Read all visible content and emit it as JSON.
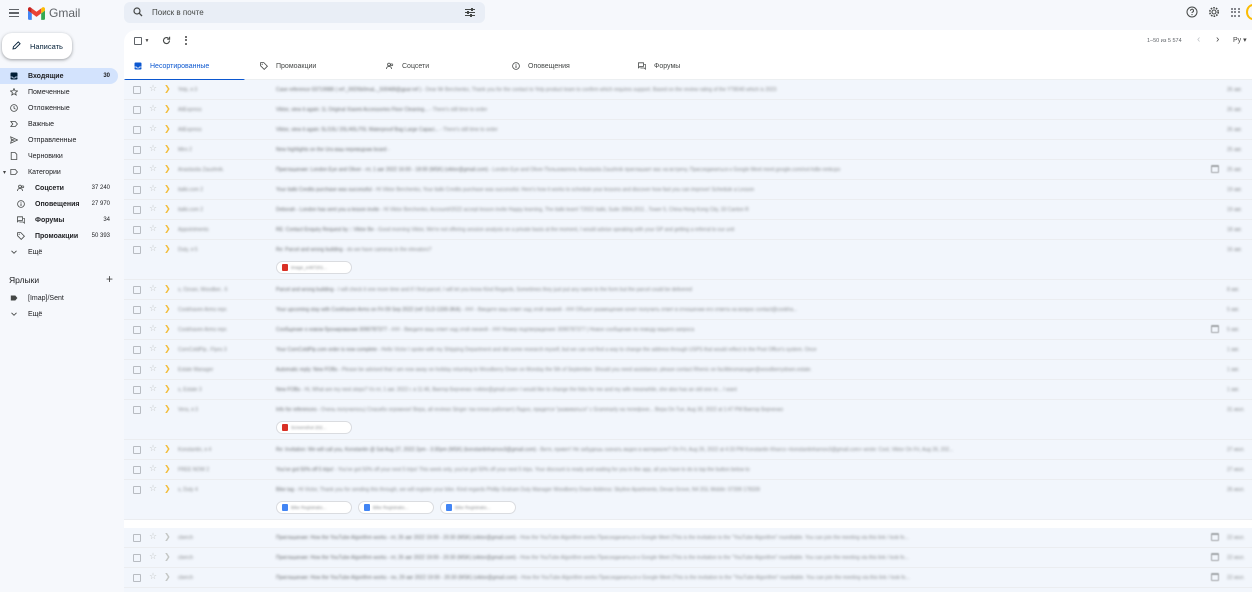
{
  "app": {
    "name": "Gmail"
  },
  "search": {
    "placeholder": "Поиск в почте"
  },
  "compose": {
    "label": "Написать"
  },
  "nav": [
    {
      "id": "inbox",
      "label": "Входящие",
      "count": "30",
      "icon": "inbox-icon"
    },
    {
      "id": "starred",
      "label": "Помеченные",
      "count": "",
      "icon": "star-icon"
    },
    {
      "id": "snoozed",
      "label": "Отложенные",
      "count": "",
      "icon": "clock-icon"
    },
    {
      "id": "important",
      "label": "Важные",
      "count": "",
      "icon": "important-icon"
    },
    {
      "id": "sent",
      "label": "Отправленные",
      "count": "",
      "icon": "send-icon"
    },
    {
      "id": "drafts",
      "label": "Черновики",
      "count": "",
      "icon": "draft-icon"
    },
    {
      "id": "categories",
      "label": "Категории",
      "count": "",
      "icon": "label-outline-icon"
    }
  ],
  "categories": [
    {
      "id": "social",
      "label": "Соцсети",
      "count": "37 240",
      "icon": "people-icon"
    },
    {
      "id": "updates",
      "label": "Оповещения",
      "count": "27 970",
      "icon": "info-icon"
    },
    {
      "id": "forums",
      "label": "Форумы",
      "count": "34",
      "icon": "forum-icon"
    },
    {
      "id": "promotions",
      "label": "Промоакции",
      "count": "50 393",
      "icon": "tag-icon"
    }
  ],
  "nav_more": "Ещё",
  "labels_section": {
    "title": "Ярлыки",
    "items": [
      {
        "label": "[Imap]/Sent"
      }
    ],
    "more": "Ещё"
  },
  "toolbar": {
    "paging": "1–50 из 5 574",
    "lang": "Ру"
  },
  "tabs": [
    {
      "id": "primary",
      "label": "Несортированные",
      "active": true,
      "icon": "inbox-icon"
    },
    {
      "id": "promotions",
      "label": "Промоакции",
      "active": false,
      "icon": "tag-icon"
    },
    {
      "id": "social",
      "label": "Соцсети",
      "active": false,
      "icon": "people-icon"
    },
    {
      "id": "updates",
      "label": "Оповещения",
      "active": false,
      "icon": "info-icon"
    },
    {
      "id": "forums",
      "label": "Форумы",
      "active": false,
      "icon": "forum-icon"
    }
  ],
  "emails": [
    {
      "sender": "Yelp, я 3",
      "subject": "Case reference 03719988 ( ref:_00D5b0maL._5004i8l@gpar:ref )",
      "snippet": " - Dear Mr Berchenko, Thank you for the contact to Yelp product team to confirm which requires support. Based on the review rating of the YT8040 which is 2023",
      "date": "26 авг.",
      "important": true,
      "calendar": false,
      "attachments": [],
      "tall": false,
      "gap": false
    },
    {
      "sender": "AliExpress",
      "subject": "Viktor, view it again: 1L Original Xiaomi Accessories Floor Cleaning...",
      "snippet": " - There's still time to order",
      "date": "26 авг.",
      "important": true,
      "calendar": false,
      "attachments": [],
      "tall": false,
      "gap": false
    },
    {
      "sender": "AliExpress",
      "subject": "Viktor, view it again: 5L/10L/ 20L/40L/70L Waterproof Bag Large Capaci...",
      "snippet": " - There's still time to order",
      "date": "26 авг.",
      "important": true,
      "calendar": false,
      "attachments": [],
      "tall": false,
      "gap": false
    },
    {
      "sender": "Miro 2",
      "subject": "New highlights on the Ura ваш переводчик board",
      "snippet": " - ",
      "date": "25 авг.",
      "important": true,
      "calendar": false,
      "attachments": [],
      "tall": false,
      "gap": false
    },
    {
      "sender": "Anastasiia Zaushnik.",
      "subject": "Приглашение: London Eye and Oliver - пт, 1 авг 2022 16:00 - 18:00 (MSK) (viktor@gmail.com)",
      "snippet": " - London Eye and Oliver Пользователь Anastasiia Zaushnik приглашает вас на встречу. Присоединиться к Google Meet meet.google.com/xvt-hdbr-nmkcpo",
      "date": "25 авг.",
      "important": true,
      "calendar": true,
      "attachments": [],
      "tall": false,
      "gap": false
    },
    {
      "sender": "italki.com 2",
      "subject": "Your italki Credits purchase was successful",
      "snippet": " - Hi Viktor Berchenko, Your italki Credits purchase was successful. Here's how it works to schedule your lessons and discover how fast you can improve! Schedule a Lesson",
      "date": "19 авг.",
      "important": true,
      "calendar": false,
      "attachments": [],
      "tall": false,
      "gap": false
    },
    {
      "sender": "italki.com 2",
      "subject": "Deborah - London has sent you a lesson invite",
      "snippet": " - Hi Viktor Berchenko, Account#2022 accept lesson invite Happy learning, The italki team! T2022 italki, Suite 2004,2011 , Tower 5, China Hong Kong City, 33 Canton R",
      "date": "19 авг.",
      "important": true,
      "calendar": false,
      "attachments": [],
      "tall": false,
      "gap": false
    },
    {
      "sender": "Appointments",
      "subject": "RE: Contact Enquiry Request by :: Viktor Be",
      "snippet": " - Good morning Viktor, We're not offering session analysis on a private basis at the moment, I would advise speaking with your GP and getting a referral to our unit",
      "date": "18 авг.",
      "important": true,
      "calendar": false,
      "attachments": [],
      "tall": false,
      "gap": false
    },
    {
      "sender": "Duty, я 5",
      "subject": "Re: Parcel and wrong building",
      "snippet": " - do we have cameras in the elevators?",
      "date": "16 авг.",
      "important": true,
      "calendar": false,
      "attachments": [
        {
          "name": "image_e487201...",
          "kind": "img"
        }
      ],
      "tall": true,
      "gap": false
    },
    {
      "sender": "s, Ozvan, Woodber.. 6",
      "subject": "Parcel and wrong building",
      "snippet": " - I will check it one more time and if I find parcel, I will let you know Kind Regards, Sometimes they just put any name to the form but the parcel could be delivered",
      "date": "8 авг.",
      "important": true,
      "calendar": false,
      "attachments": [],
      "tall": false,
      "gap": false
    },
    {
      "sender": "Cookhaven Arms repr.",
      "subject": "Your upcoming stay with Cookhaven Arms on Fri 09 Sep 2022 (ref: CLD-1330-3KA)",
      "snippet": " - ### - Введите ваш ответ над этой линией - ### Объект размещения хочет получить ответ в отношении его ответа на вопрос contact@cookha...",
      "date": "5 авг.",
      "important": true,
      "calendar": false,
      "attachments": [],
      "tall": false,
      "gap": false
    },
    {
      "sender": "Cookhaven Arms repr.",
      "subject": "Сообщение о новом бронировании 3090787377",
      "snippet": " - ### - Введите ваш ответ над этой линией - ### Номер подтверждения: 3090787377 | Новое сообщение по поводу вашего запроса",
      "date": "5 авг.",
      "important": true,
      "calendar": true,
      "attachments": [],
      "tall": false,
      "gap": false
    },
    {
      "sender": "CornColdPip.. Flyes 3",
      "subject": "Your CornColdPip.com order is now complete",
      "snippet": " - Hello Victor I spoke with my Shipping Department and did some research myself, but we can not find a way to change the address through USPS that would reflect in the Post Office's system. Once",
      "date": "1 авг.",
      "important": true,
      "calendar": false,
      "attachments": [],
      "tall": false,
      "gap": false
    },
    {
      "sender": "Estate Manager",
      "subject": "Automatic reply: New FOBs",
      "snippet": " - Please be advised that I am now away on holiday returning to Woodberry Down on Monday the 5th of September. Should you need assistance, please contact Rhenic on facilitiesmanager@woodberrydown.estate.",
      "date": "1 авг.",
      "important": true,
      "calendar": false,
      "attachments": [],
      "tall": false,
      "gap": false
    },
    {
      "sender": "s, Estate 3",
      "subject": "New FOBs",
      "snippet": " - Hi, What are my next steps? Vs пт, 1 авг. 2022 г. в 11:46, Виктор Берченко <viktor@gmail.com> I would like to change the fobs for me and my wife meanwhile, she also has an old one re... I want",
      "date": "1 авг.",
      "important": true,
      "calendar": false,
      "attachments": [],
      "tall": false,
      "gap": false
    },
    {
      "sender": "Vera, я 3",
      "subject": "Info for references",
      "snippet": " - Очень получилось) Спасибо огромное! Вера, all reviews Singer так плохо работает) Ладно, придется \"развиваться\" с Grammarly на телефоне... Вера On Tue, Aug 30, 2022 at 1:47 PM Виктор Берченко",
      "date": "31 июл.",
      "important": true,
      "calendar": false,
      "attachments": [
        {
          "name": "Screenshot 202...",
          "kind": "img"
        }
      ],
      "tall": true,
      "gap": false
    },
    {
      "sender": "Konstantin, я 4",
      "subject": "Re: Invitation: We will call you, Konstantin @ Sat Aug 27, 2022 2pm - 3:30pm (MSK) (konstantinharnov3@gmail.com)",
      "snippet": " - Витя, привет! Не забудешь скачать видео в материале? On Fri, Aug 26, 2022 at 4:33 PM Konstantin Kharco <konstantinharnov3@gmail.com> wrote: Cool, Viktor On Fri, Aug 26, 202...",
      "date": "27 июл.",
      "important": true,
      "calendar": false,
      "attachments": [],
      "tall": false,
      "gap": false
    },
    {
      "sender": "FREE NOW 2",
      "subject": "You've got 50% off 5 trips!",
      "snippet": " - You've got 50% off your next 5 trips! This week only, you've got 50% off your next 5 trips. Your discount is ready and waiting for you in the app, all you have to do is tap the button below to",
      "date": "27 июл.",
      "important": true,
      "calendar": false,
      "attachments": [],
      "tall": false,
      "gap": false
    },
    {
      "sender": "s, Duty 4",
      "subject": "Bike tag",
      "snippet": " - Hi Victor, Thank you for sending this through, we will register your bike. Kind regards Phillip Graham Duty Manager Woodberry Down Address: Skyline Apartments, Devan Grove, N4 2GL Mobile: 07399 178339",
      "date": "26 июл.",
      "important": true,
      "calendar": false,
      "attachments": [
        {
          "name": "Bike Registratio...",
          "kind": "doc"
        },
        {
          "name": "Bike Registratio...",
          "kind": "doc"
        },
        {
          "name": "Bike Registratio...",
          "kind": "doc"
        }
      ],
      "tall": true,
      "gap": false
    },
    {
      "sender": "cberch",
      "subject": "Приглашение: How the YouTube Algorithm works - пт, 26 авг 2022 19:00 - 20:30 (MSK) (viktor@gmail.com)",
      "snippet": " - How the YouTube Algorithm works Присоединиться к Google Meet (This is the invitation to the \"YouTube Algorithm\" roundtable. You can join the meeting via this link / look fo...",
      "date": "22 июл.",
      "important": false,
      "calendar": true,
      "attachments": [],
      "tall": false,
      "gap": true
    },
    {
      "sender": "cberch",
      "subject": "Приглашение: How the YouTube Algorithm works - пт, 26 авг 2022 19:00 - 20:30 (MSK) (viktor@gmail.com)",
      "snippet": " - How the YouTube Algorithm works Присоединиться к Google Meet (This is the invitation to the \"YouTube Algorithm\" roundtable. You can join the meeting via this link / look fo...",
      "date": "22 июл.",
      "important": false,
      "calendar": true,
      "attachments": [],
      "tall": false,
      "gap": false
    },
    {
      "sender": "cberch",
      "subject": "Приглашение: How the YouTube Algorithm works - пн, 29 авг 2022 19:00 - 20:30 (MSK) (viktor@gmail.com)",
      "snippet": " - How the YouTube Algorithm works Присоединиться к Google Meet (This is the invitation to the \"YouTube Algorithm\" roundtable. You can join the meeting via this link / look fo...",
      "date": "22 июл.",
      "important": false,
      "calendar": true,
      "attachments": [],
      "tall": false,
      "gap": false
    },
    {
      "sender": "cberch",
      "subject": "Приглашение: How the YouTube Algorithm works - пн, 29 авг 2022 19:00 - 20:30 (MSK) (viktor@gmail.com)",
      "snippet": " - How the YouTube Algorithm works Присоединиться к Google Meet (This is the invitation to the \"YouTube Algorithm\" roundtable. You can join the meeting via this link / look fo...",
      "date": "22 июл.",
      "important": false,
      "calendar": true,
      "attachments": [],
      "tall": false,
      "gap": false
    }
  ],
  "colors": {
    "accent": "#0b57d0",
    "active_nav": "#d3e3fd",
    "important": "#f2bd3c",
    "background": "#f6f8fc"
  }
}
